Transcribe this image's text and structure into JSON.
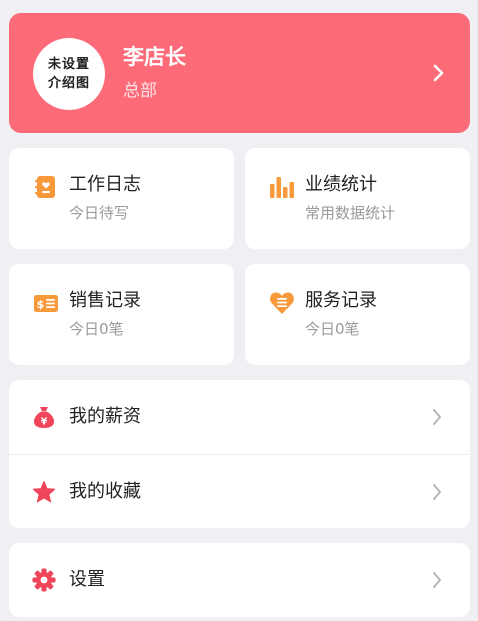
{
  "profile": {
    "avatar_line1": "未设置",
    "avatar_line2": "介绍图",
    "name": "李店长",
    "department": "总部"
  },
  "tiles": [
    {
      "title": "工作日志",
      "subtitle": "今日待写",
      "icon": "notebook-icon"
    },
    {
      "title": "业绩统计",
      "subtitle": "常用数据统计",
      "icon": "bar-chart-icon"
    },
    {
      "title": "销售记录",
      "subtitle": "今日0笔",
      "icon": "receipt-icon"
    },
    {
      "title": "服务记录",
      "subtitle": "今日0笔",
      "icon": "heart-list-icon"
    }
  ],
  "menu": {
    "salary": "我的薪资",
    "favorites": "我的收藏",
    "settings": "设置"
  },
  "colors": {
    "accent": "#fc6b77",
    "orange": "#f89a3c",
    "red_icon": "#f0455a",
    "background": "#efeff4"
  }
}
